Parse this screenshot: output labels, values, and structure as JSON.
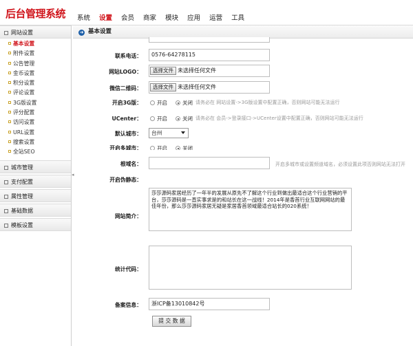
{
  "app": {
    "logo_text": "后台管理系统"
  },
  "topnav": [
    {
      "label": "系统",
      "active": false
    },
    {
      "label": "设置",
      "active": true
    },
    {
      "label": "会员",
      "active": false
    },
    {
      "label": "商家",
      "active": false
    },
    {
      "label": "模块",
      "active": false
    },
    {
      "label": "应用",
      "active": false
    },
    {
      "label": "运营",
      "active": false
    },
    {
      "label": "工具",
      "active": false
    }
  ],
  "sidebar": {
    "group_main": "网站设置",
    "items": [
      {
        "label": "基本设置",
        "active": true
      },
      {
        "label": "附件设置"
      },
      {
        "label": "公告管理"
      },
      {
        "label": "金币设置"
      },
      {
        "label": "积分设置"
      },
      {
        "label": "评论设置"
      },
      {
        "label": "3G版设置"
      },
      {
        "label": "评分配置"
      },
      {
        "label": "访问设置"
      },
      {
        "label": "URL设置"
      },
      {
        "label": "搜索设置"
      },
      {
        "label": "全站SEO"
      }
    ],
    "groups": [
      "城市管理",
      "支付配置",
      "属性管理",
      "基础数据",
      "模板设置"
    ]
  },
  "main": {
    "title": "基本设置",
    "phone_label": "联系电话：",
    "phone_value": "0576-64278115",
    "logo_label": "网站LOGO：",
    "wechat_label": "微信二维码：",
    "file_button": "选择文件",
    "file_none": "未选择任何文件",
    "g3_label": "开启3G版：",
    "opt_on": "开启",
    "opt_off": "关闭",
    "g3_hint": "请务必在 网站设置->3G版设置中配置正确，否则网站可能无法运行",
    "ucenter_label": "UCenter：",
    "ucenter_hint": "请务必在 会员->登录接口->UCenter设置中配置正确，否则网站可能无法运行",
    "default_city_label": "默认城市：",
    "default_city_value": "台州",
    "multicity_label": "开启多城市：",
    "rootdomain_label": "根域名：",
    "rootdomain_hint": "开启多城市或设置频道域名，必须设置此项否则网站无法打开",
    "pseudo_label": "开启伪静态：",
    "intro_label": "网站简介：",
    "intro_text": "莎莎源码家居经历了一年半的发展从原先不了解这个行业到做出最适合这个行业营销的平台，莎莎源码是一直实事求是的和站长在这一战线！2014年是香首行业互联网网站的最佳年份，那么莎莎源码家居无疑是家居香首领域最适合站长的020系统！",
    "stats_label": "统计代码：",
    "stats_text": "",
    "icp_label": "备案信息：",
    "icp_value": "浙ICP备13010842号",
    "submit_label": "提 交 数 据"
  }
}
